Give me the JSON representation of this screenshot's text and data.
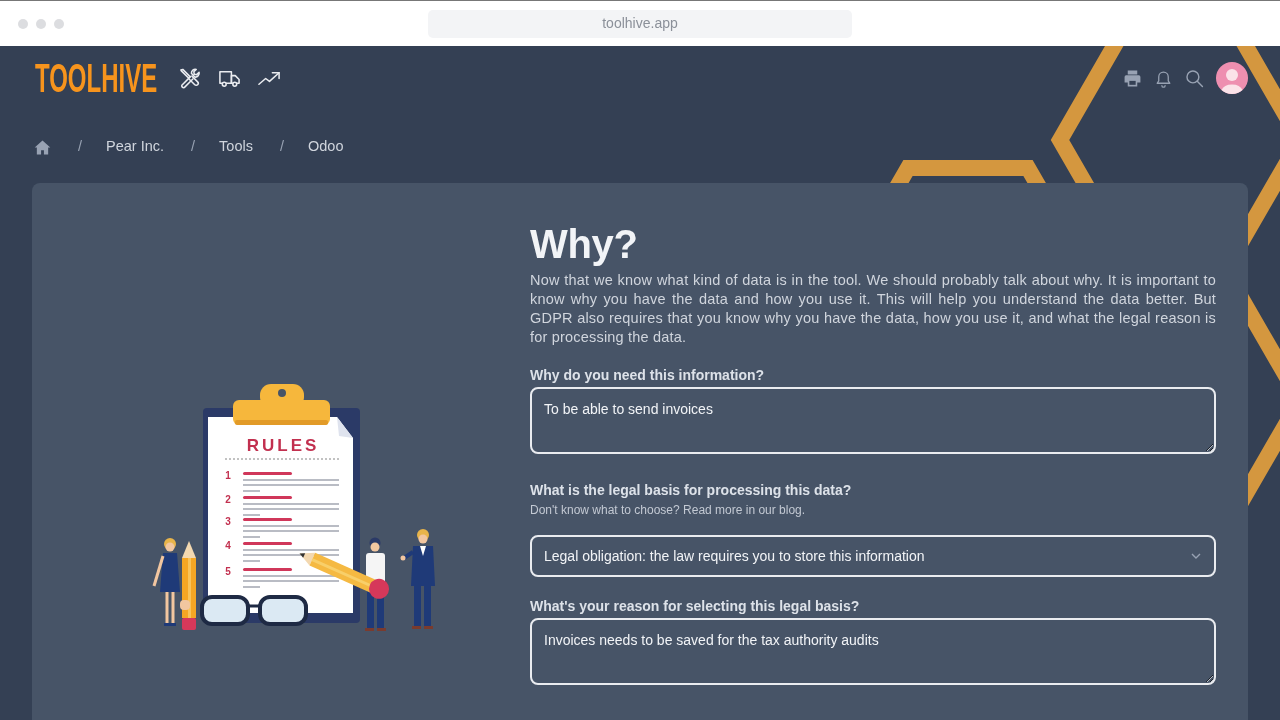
{
  "browser": {
    "url": "toolhive.app"
  },
  "header": {
    "logo": "TOOLHIVE"
  },
  "breadcrumbs": [
    {
      "separator": "/",
      "label": "Pear Inc."
    },
    {
      "separator": "/",
      "label": "Tools"
    },
    {
      "separator": "/",
      "label": "Odoo"
    }
  ],
  "illustration": {
    "title": "RULES",
    "rule_numbers": [
      "1",
      "2",
      "3",
      "4",
      "5"
    ]
  },
  "section": {
    "title": "Why?",
    "intro": "Now that we know what kind of data is in the tool. We should probably talk about why. It is important to know why you have the data and how you use it. This will help you understand the data better. But GDPR also requires that you know why you have the data, how you use it, and what the legal reason is for processing the data.",
    "fields": [
      {
        "kind": "textarea",
        "label": "Why do you need this information?",
        "value": "To be able to send invoices"
      },
      {
        "kind": "select",
        "label": "What is the legal basis for processing this data?",
        "hint": "Don't know what to choose? Read more in our blog.",
        "value": "Legal obligation: the law requires you to store this information"
      },
      {
        "kind": "textarea",
        "label": "What's your reason for selecting this legal basis?",
        "value": "Invoices needs to be saved for the tax authority audits"
      }
    ]
  }
}
